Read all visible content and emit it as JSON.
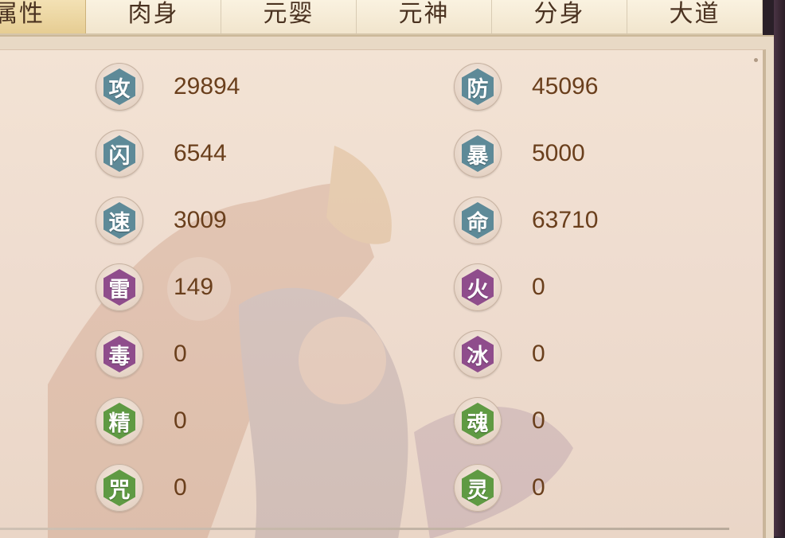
{
  "tabs": [
    {
      "label": "属性",
      "active": true
    },
    {
      "label": "肉身",
      "active": false
    },
    {
      "label": "元婴",
      "active": false
    },
    {
      "label": "元神",
      "active": false
    },
    {
      "label": "分身",
      "active": false
    },
    {
      "label": "大道",
      "active": false
    }
  ],
  "colors": {
    "blue_badge": "#5e8a98",
    "purple_badge": "#8f4d8c",
    "green_badge": "#5f9a43",
    "value_text": "#6a3f1c",
    "tab_active": "#e6cd93"
  },
  "stats_left": [
    {
      "char": "攻",
      "value": "29894",
      "color": "blue"
    },
    {
      "char": "闪",
      "value": "6544",
      "color": "blue"
    },
    {
      "char": "速",
      "value": "3009",
      "color": "blue"
    },
    {
      "char": "雷",
      "value": "149",
      "color": "purple"
    },
    {
      "char": "毒",
      "value": "0",
      "color": "purple"
    },
    {
      "char": "精",
      "value": "0",
      "color": "green"
    },
    {
      "char": "咒",
      "value": "0",
      "color": "green"
    }
  ],
  "stats_right": [
    {
      "char": "防",
      "value": "45096",
      "color": "blue"
    },
    {
      "char": "暴",
      "value": "5000",
      "color": "blue"
    },
    {
      "char": "命",
      "value": "63710",
      "color": "blue"
    },
    {
      "char": "火",
      "value": "0",
      "color": "purple"
    },
    {
      "char": "冰",
      "value": "0",
      "color": "purple"
    },
    {
      "char": "魂",
      "value": "0",
      "color": "green"
    },
    {
      "char": "灵",
      "value": "0",
      "color": "green"
    }
  ]
}
